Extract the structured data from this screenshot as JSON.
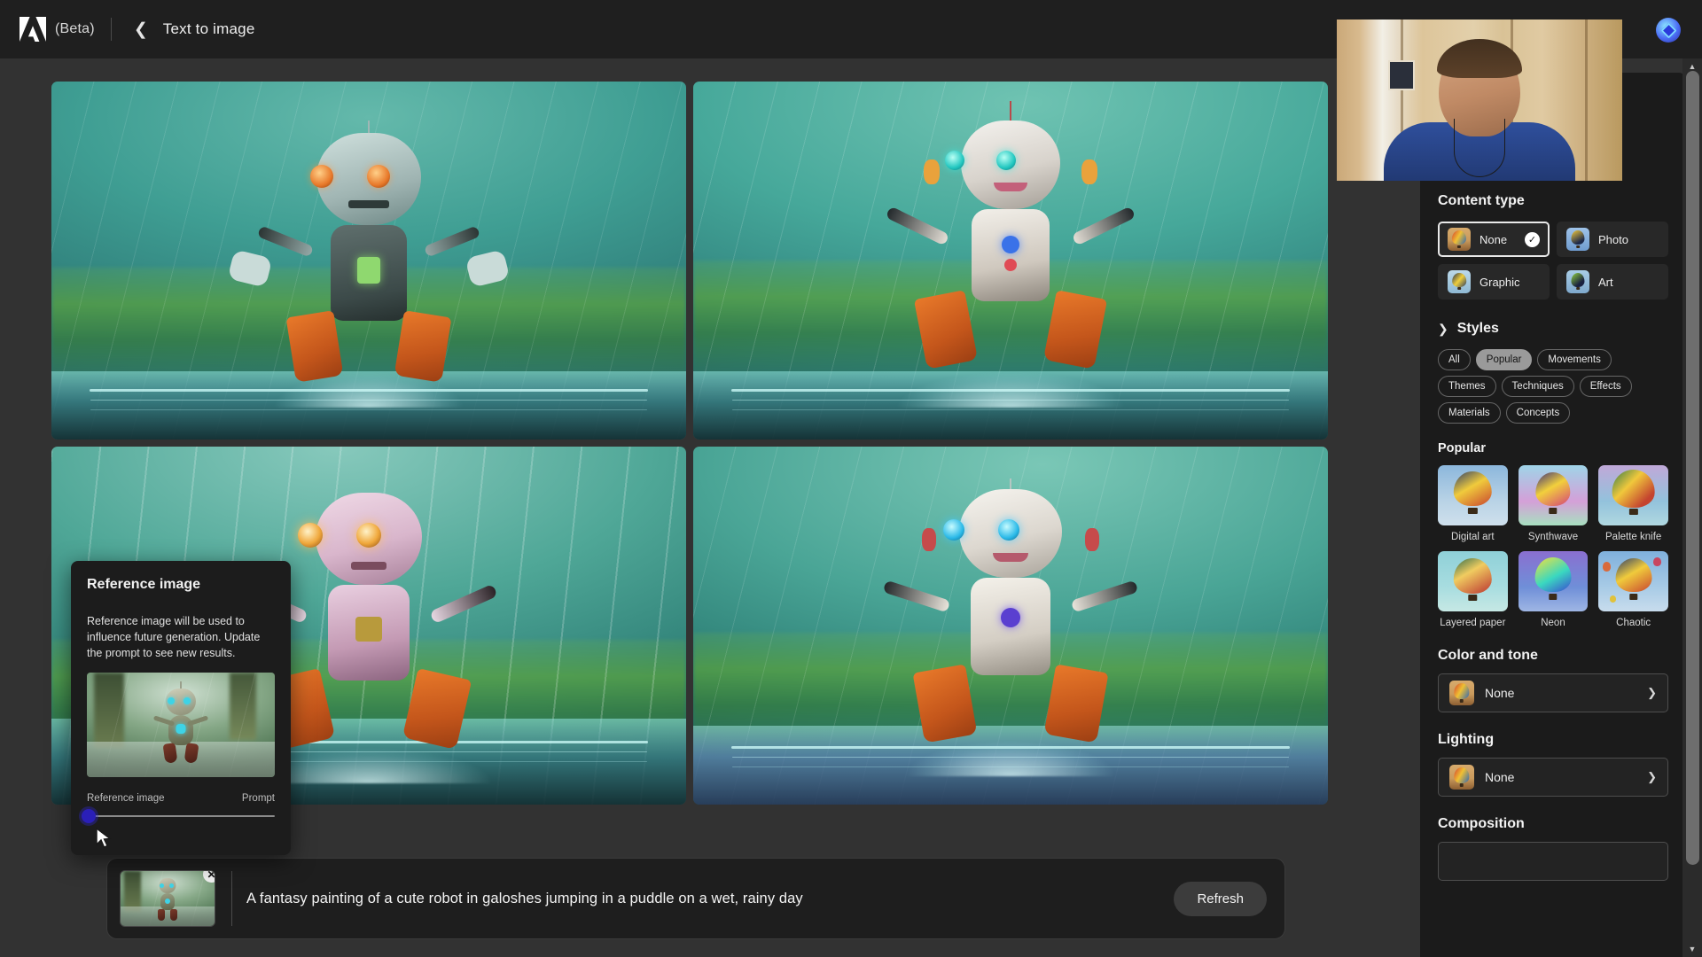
{
  "app": {
    "logo_icon": "adobe-logo-icon",
    "beta_label": "(Beta)",
    "back_icon": "chevron-left-icon",
    "title": "Text to image"
  },
  "results": {
    "images": [
      {
        "alt": "generated robot in puddle variation 1"
      },
      {
        "alt": "generated robot in puddle variation 2"
      },
      {
        "alt": "generated robot in puddle variation 3"
      },
      {
        "alt": "generated robot in puddle variation 4"
      }
    ]
  },
  "reference_popup": {
    "title": "Reference image",
    "description": "Reference image will be used to influence future generation. Update the prompt to see new results.",
    "thumbnail_alt": "reference robot in rain",
    "slider": {
      "left_label": "Reference image",
      "right_label": "Prompt",
      "value": 0
    }
  },
  "prompt_bar": {
    "thumbnail_alt": "reference robot in rain",
    "remove_icon": "close-icon",
    "text": "A fantasy painting of a cute robot in galoshes jumping in a puddle on a wet, rainy day",
    "refresh_label": "Refresh"
  },
  "panel": {
    "content_type": {
      "title": "Content type",
      "options": [
        {
          "label": "None",
          "selected": true,
          "check_icon": "check-icon"
        },
        {
          "label": "Photo",
          "selected": false
        },
        {
          "label": "Graphic",
          "selected": false
        },
        {
          "label": "Art",
          "selected": false
        }
      ]
    },
    "styles": {
      "title": "Styles",
      "chevron_icon": "chevron-right-icon",
      "filters": [
        {
          "label": "All",
          "selected": false
        },
        {
          "label": "Popular",
          "selected": true
        },
        {
          "label": "Movements",
          "selected": false
        },
        {
          "label": "Themes",
          "selected": false
        },
        {
          "label": "Techniques",
          "selected": false
        },
        {
          "label": "Effects",
          "selected": false
        },
        {
          "label": "Materials",
          "selected": false
        },
        {
          "label": "Concepts",
          "selected": false
        }
      ],
      "group_title": "Popular",
      "items": [
        {
          "label": "Digital art"
        },
        {
          "label": "Synthwave"
        },
        {
          "label": "Palette knife"
        },
        {
          "label": "Layered paper"
        },
        {
          "label": "Neon"
        },
        {
          "label": "Chaotic"
        }
      ]
    },
    "color_and_tone": {
      "title": "Color and tone",
      "value": "None",
      "chevron_icon": "chevron-down-icon"
    },
    "lighting": {
      "title": "Lighting",
      "value": "None",
      "chevron_icon": "chevron-down-icon"
    },
    "composition": {
      "title": "Composition"
    }
  },
  "overlay": {
    "webcam_alt": "presenter webcam feed",
    "avatar_icon": "app-avatar-icon"
  },
  "scrollbar": {
    "up_icon": "scroll-up-icon",
    "down_icon": "scroll-down-icon"
  },
  "colors": {
    "app_bg": "#323232",
    "topbar_bg": "#1f1f1f",
    "panel_bg": "#1b1b1b",
    "accent_selected": "#9a9a9a",
    "slider_knob": "#2a1fb8"
  }
}
